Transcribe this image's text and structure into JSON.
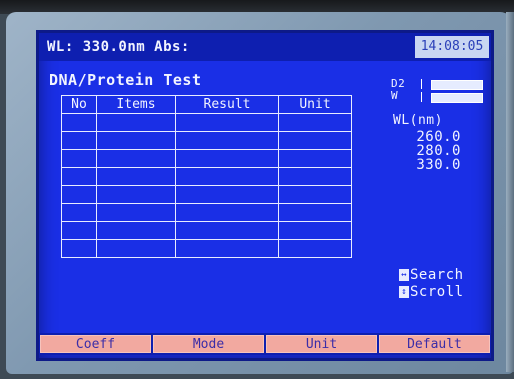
{
  "header": {
    "wavelength_status": "WL: 330.0nm Abs:",
    "time": "14:08:05"
  },
  "page_title": "DNA/Protein Test",
  "lamps": {
    "d2_label": "D2",
    "w_label": "W"
  },
  "wavelength_panel": {
    "header": "WL(nm)",
    "values": [
      "260.0",
      "280.0",
      "330.0"
    ]
  },
  "table": {
    "columns": [
      "No",
      "Items",
      "Result",
      "Unit"
    ],
    "rows": [
      [
        "",
        "",
        "",
        ""
      ],
      [
        "",
        "",
        "",
        ""
      ],
      [
        "",
        "",
        "",
        ""
      ],
      [
        "",
        "",
        "",
        ""
      ],
      [
        "",
        "",
        "",
        ""
      ],
      [
        "",
        "",
        "",
        ""
      ],
      [
        "",
        "",
        "",
        ""
      ],
      [
        "",
        "",
        "",
        ""
      ]
    ]
  },
  "navigation": {
    "search_icon": "left-right-arrow-icon",
    "search_label": "Search",
    "scroll_icon": "up-down-arrow-icon",
    "scroll_label": "Scroll"
  },
  "softkeys": [
    "Coeff",
    "Mode",
    "Unit",
    "Default"
  ],
  "colors": {
    "screen_bg": "#1a2fe6",
    "softkey_bg": "#f2a9a0",
    "text": "#f2f4ff"
  }
}
